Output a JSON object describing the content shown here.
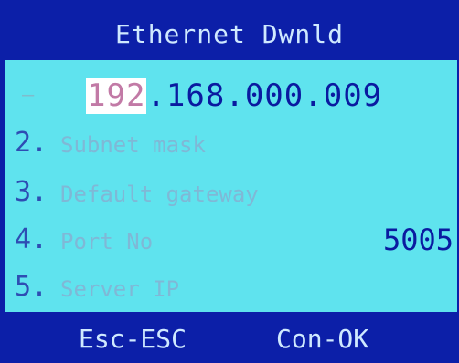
{
  "window": {
    "title": "Ethernet Dwnld"
  },
  "ip_editor": {
    "octets": [
      "192",
      "168",
      "000",
      "009"
    ],
    "separator": "."
  },
  "menu": {
    "items": [
      {
        "number": "2.",
        "label": "Subnet mask",
        "value": ""
      },
      {
        "number": "3.",
        "label": "Default gateway",
        "value": ""
      },
      {
        "number": "4.",
        "label": "Port No",
        "value": "5005"
      },
      {
        "number": "5.",
        "label": "Server IP",
        "value": ""
      }
    ]
  },
  "footer": {
    "esc_label": "Esc-ESC",
    "ok_label": "Con-OK"
  },
  "colors": {
    "frame": "#0c1fa8",
    "panel": "#5fe3ee",
    "value_text": "#0a1aa0",
    "label_text": "#7fb8d6",
    "selection_bg": "#ffffff"
  }
}
